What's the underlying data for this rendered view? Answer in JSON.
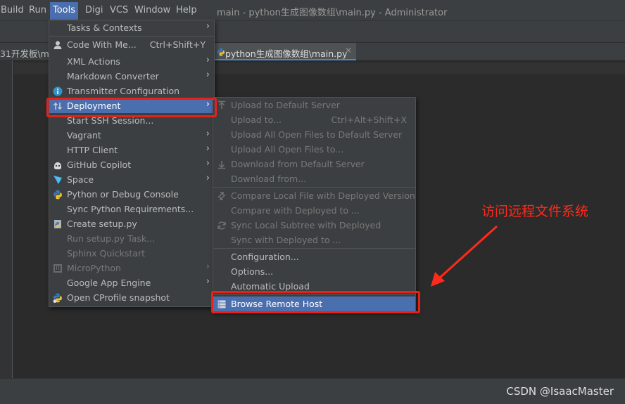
{
  "menubar": {
    "items": [
      "Build",
      "Run",
      "Tools",
      "Digi",
      "VCS",
      "Window",
      "Help"
    ],
    "window_title": "main - python生成图像数组\\main.py - Administrator"
  },
  "tabs": {
    "left_tab": "31开发板\\ma",
    "active_tab": "python生成图像数组\\main.py",
    "close_glyph": "✕"
  },
  "tools_menu": {
    "items": [
      {
        "label": "Tasks & Contexts",
        "shortcut": "",
        "submenu": true,
        "disabled": false
      },
      {
        "label": "Code With Me...",
        "shortcut": "Ctrl+Shift+Y",
        "submenu": false,
        "disabled": false,
        "icon": "person-icon"
      },
      {
        "label": "XML Actions",
        "shortcut": "",
        "submenu": true,
        "disabled": false
      },
      {
        "label": "Markdown Converter",
        "shortcut": "",
        "submenu": true,
        "disabled": false
      },
      {
        "label": "Transmitter Configuration",
        "shortcut": "",
        "submenu": false,
        "disabled": false,
        "icon": "info-icon"
      },
      {
        "label": "Deployment",
        "shortcut": "",
        "submenu": true,
        "disabled": false,
        "icon": "transfer-icon"
      },
      {
        "label": "Start SSH Session...",
        "shortcut": "",
        "submenu": false,
        "disabled": false
      },
      {
        "label": "Vagrant",
        "shortcut": "",
        "submenu": true,
        "disabled": false
      },
      {
        "label": "HTTP Client",
        "shortcut": "",
        "submenu": true,
        "disabled": false
      },
      {
        "label": "GitHub Copilot",
        "shortcut": "",
        "submenu": true,
        "disabled": false,
        "icon": "copilot-icon"
      },
      {
        "label": "Space",
        "shortcut": "",
        "submenu": true,
        "disabled": false,
        "icon": "space-icon"
      },
      {
        "label": "Python or Debug Console",
        "shortcut": "",
        "submenu": false,
        "disabled": false,
        "icon": "python-icon"
      },
      {
        "label": "Sync Python Requirements...",
        "shortcut": "",
        "submenu": false,
        "disabled": false
      },
      {
        "label": "Create setup.py",
        "shortcut": "",
        "submenu": false,
        "disabled": false,
        "icon": "python-file-icon"
      },
      {
        "label": "Run setup.py Task...",
        "shortcut": "",
        "submenu": false,
        "disabled": true
      },
      {
        "label": "Sphinx Quickstart",
        "shortcut": "",
        "submenu": false,
        "disabled": true
      },
      {
        "label": "MicroPython",
        "shortcut": "",
        "submenu": true,
        "disabled": true,
        "icon": "micropython-icon"
      },
      {
        "label": "Google App Engine",
        "shortcut": "",
        "submenu": true,
        "disabled": false
      },
      {
        "label": "Open CProfile snapshot",
        "shortcut": "",
        "submenu": false,
        "disabled": false,
        "icon": "python-profile-icon"
      }
    ]
  },
  "deployment_menu": {
    "groups": [
      [
        {
          "label": "Upload to Default Server",
          "shortcut": "",
          "disabled": true,
          "icon": "upload-icon"
        },
        {
          "label": "Upload to...",
          "shortcut": "Ctrl+Alt+Shift+X",
          "disabled": true
        },
        {
          "label": "Upload All Open Files to Default Server",
          "shortcut": "",
          "disabled": true
        },
        {
          "label": "Upload All Open Files to...",
          "shortcut": "",
          "disabled": true
        },
        {
          "label": "Download from Default Server",
          "shortcut": "",
          "disabled": true,
          "icon": "download-icon"
        },
        {
          "label": "Download from...",
          "shortcut": "",
          "disabled": true
        }
      ],
      [
        {
          "label": "Compare Local File with Deployed Version",
          "shortcut": "",
          "disabled": true,
          "icon": "compare-icon"
        },
        {
          "label": "Compare with Deployed to ...",
          "shortcut": "",
          "disabled": true
        },
        {
          "label": "Sync Local Subtree with Deployed",
          "shortcut": "",
          "disabled": true,
          "icon": "sync-icon"
        },
        {
          "label": "Sync with Deployed to ...",
          "shortcut": "",
          "disabled": true
        }
      ],
      [
        {
          "label": "Configuration...",
          "shortcut": "",
          "disabled": false
        },
        {
          "label": "Options...",
          "shortcut": "",
          "disabled": false
        },
        {
          "label": "Automatic Upload",
          "shortcut": "",
          "disabled": false
        }
      ],
      [
        {
          "label": "Browse Remote Host",
          "shortcut": "",
          "disabled": false,
          "icon": "remote-host-icon",
          "selected": true
        }
      ]
    ]
  },
  "annotation": {
    "text": "访问远程文件系统",
    "color": "#ff2a1a"
  },
  "watermark": "CSDN @IsaacMaster",
  "colors": {
    "menu_bg": "#3c3f41",
    "selection": "#4b6eaf",
    "highlight_box": "#e8201a",
    "editor_bg": "#2b2b2b"
  }
}
